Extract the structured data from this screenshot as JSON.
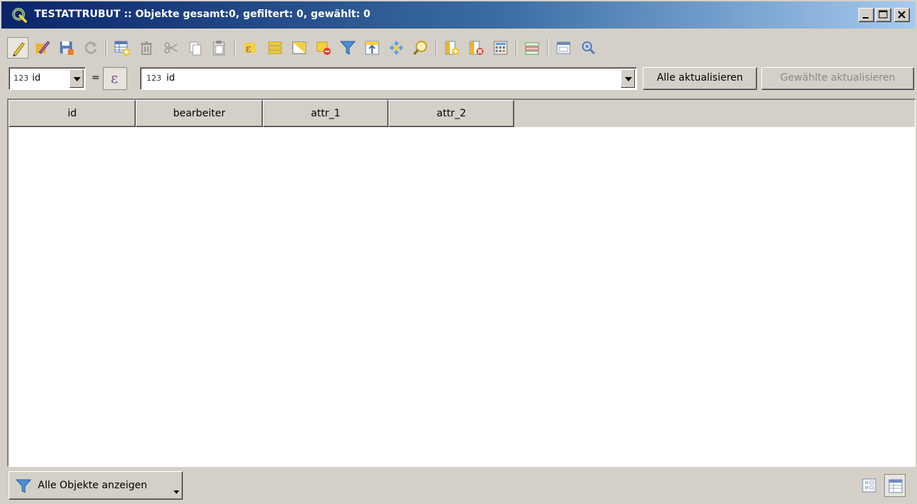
{
  "window": {
    "title": "TESTATTRUBUT :: Objekte gesamt:0, gefiltert: 0, gewählt: 0"
  },
  "toolbar": {
    "icons": [
      "pencil-icon",
      "multi-edit-icon",
      "save-edits-icon",
      "reload-icon",
      "add-feature-icon",
      "delete-feature-icon",
      "cut-icon",
      "copy-icon",
      "paste-icon",
      "select-by-expression-icon",
      "select-all-icon",
      "invert-selection-icon",
      "deselect-all-icon",
      "filter-icon",
      "move-selection-to-top-icon",
      "pan-to-selection-icon",
      "zoom-to-selection-icon",
      "new-field-icon",
      "delete-field-icon",
      "field-calculator-icon",
      "conditional-formatting-icon",
      "dock-icon",
      "actions-icon"
    ]
  },
  "calc": {
    "field_type": "123",
    "field_value": "id",
    "equals": "=",
    "epsilon": "ε",
    "expr_type": "123",
    "expr_value": "id",
    "update_all": "Alle aktualisieren",
    "update_selected": "Gewählte aktualisieren"
  },
  "table": {
    "columns": [
      "id",
      "bearbeiter",
      "attr_1",
      "attr_2"
    ],
    "rows": []
  },
  "bottom": {
    "filter_label": "Alle Objekte anzeigen"
  },
  "colors": {
    "title_start": "#0a246a",
    "title_end": "#a6caf0",
    "face": "#d4d0c8",
    "qgis_green": "#589632"
  }
}
